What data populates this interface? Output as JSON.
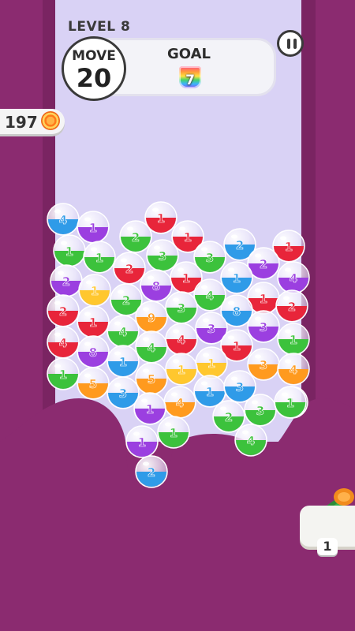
{
  "hud": {
    "level_label": "LEVEL 8",
    "move_label": "MOVE",
    "move_value": "20",
    "goal_label": "GOAL",
    "goal_value": "7",
    "coins": "197",
    "booster_count": "1"
  },
  "colors": {
    "background": "#8b2b70",
    "playfield": "#d9d2f5",
    "red": "#e8253a",
    "green": "#3cc23c",
    "blue": "#2f9be8",
    "purple": "#9b3fe0",
    "orange": "#ff9a1e",
    "yellow": "#ffc72e"
  },
  "icons": {
    "pause": "pause-icon",
    "coin": "coin-icon",
    "goal_cup": "rainbow-cup-icon",
    "booster": "cannon-booster-icon"
  },
  "bubbles": [
    {
      "label": "4",
      "color": "blue"
    },
    {
      "label": "1",
      "color": "purple"
    },
    {
      "label": "1",
      "color": "red"
    },
    {
      "label": "2",
      "color": "green"
    },
    {
      "label": "1",
      "color": "red"
    },
    {
      "label": "2",
      "color": "blue"
    },
    {
      "label": "1",
      "color": "red"
    },
    {
      "label": "1",
      "color": "green"
    },
    {
      "label": "1",
      "color": "green"
    },
    {
      "label": "3",
      "color": "green"
    },
    {
      "label": "3",
      "color": "green"
    },
    {
      "label": "2",
      "color": "purple"
    },
    {
      "label": "2",
      "color": "purple"
    },
    {
      "label": "2",
      "color": "red"
    },
    {
      "label": "1",
      "color": "blue"
    },
    {
      "label": "4",
      "color": "purple"
    },
    {
      "label": "8",
      "color": "purple"
    },
    {
      "label": "1",
      "color": "red"
    },
    {
      "label": "1",
      "color": "yellow"
    },
    {
      "label": "2",
      "color": "green"
    },
    {
      "label": "4",
      "color": "green"
    },
    {
      "label": "1",
      "color": "red"
    },
    {
      "label": "2",
      "color": "red"
    },
    {
      "label": "8",
      "color": "blue"
    },
    {
      "label": "2",
      "color": "red"
    },
    {
      "label": "3",
      "color": "green"
    },
    {
      "label": "9",
      "color": "orange"
    },
    {
      "label": "1",
      "color": "red"
    },
    {
      "label": "3",
      "color": "purple"
    },
    {
      "label": "4",
      "color": "green"
    },
    {
      "label": "3",
      "color": "purple"
    },
    {
      "label": "4",
      "color": "red"
    },
    {
      "label": "1",
      "color": "green"
    },
    {
      "label": "8",
      "color": "purple"
    },
    {
      "label": "4",
      "color": "red"
    },
    {
      "label": "4",
      "color": "green"
    },
    {
      "label": "1",
      "color": "red"
    },
    {
      "label": "1",
      "color": "green"
    },
    {
      "label": "1",
      "color": "blue"
    },
    {
      "label": "1",
      "color": "yellow"
    },
    {
      "label": "1",
      "color": "yellow"
    },
    {
      "label": "3",
      "color": "orange"
    },
    {
      "label": "4",
      "color": "orange"
    },
    {
      "label": "1",
      "color": "green"
    },
    {
      "label": "5",
      "color": "orange"
    },
    {
      "label": "5",
      "color": "orange"
    },
    {
      "label": "3",
      "color": "blue"
    },
    {
      "label": "1",
      "color": "blue"
    },
    {
      "label": "3",
      "color": "blue"
    },
    {
      "label": "4",
      "color": "orange"
    },
    {
      "label": "1",
      "color": "purple"
    },
    {
      "label": "2",
      "color": "green"
    },
    {
      "label": "3",
      "color": "green"
    },
    {
      "label": "1",
      "color": "green"
    },
    {
      "label": "1",
      "color": "green"
    },
    {
      "label": "1",
      "color": "purple"
    },
    {
      "label": "4",
      "color": "green"
    },
    {
      "label": "2",
      "color": "blue"
    }
  ]
}
